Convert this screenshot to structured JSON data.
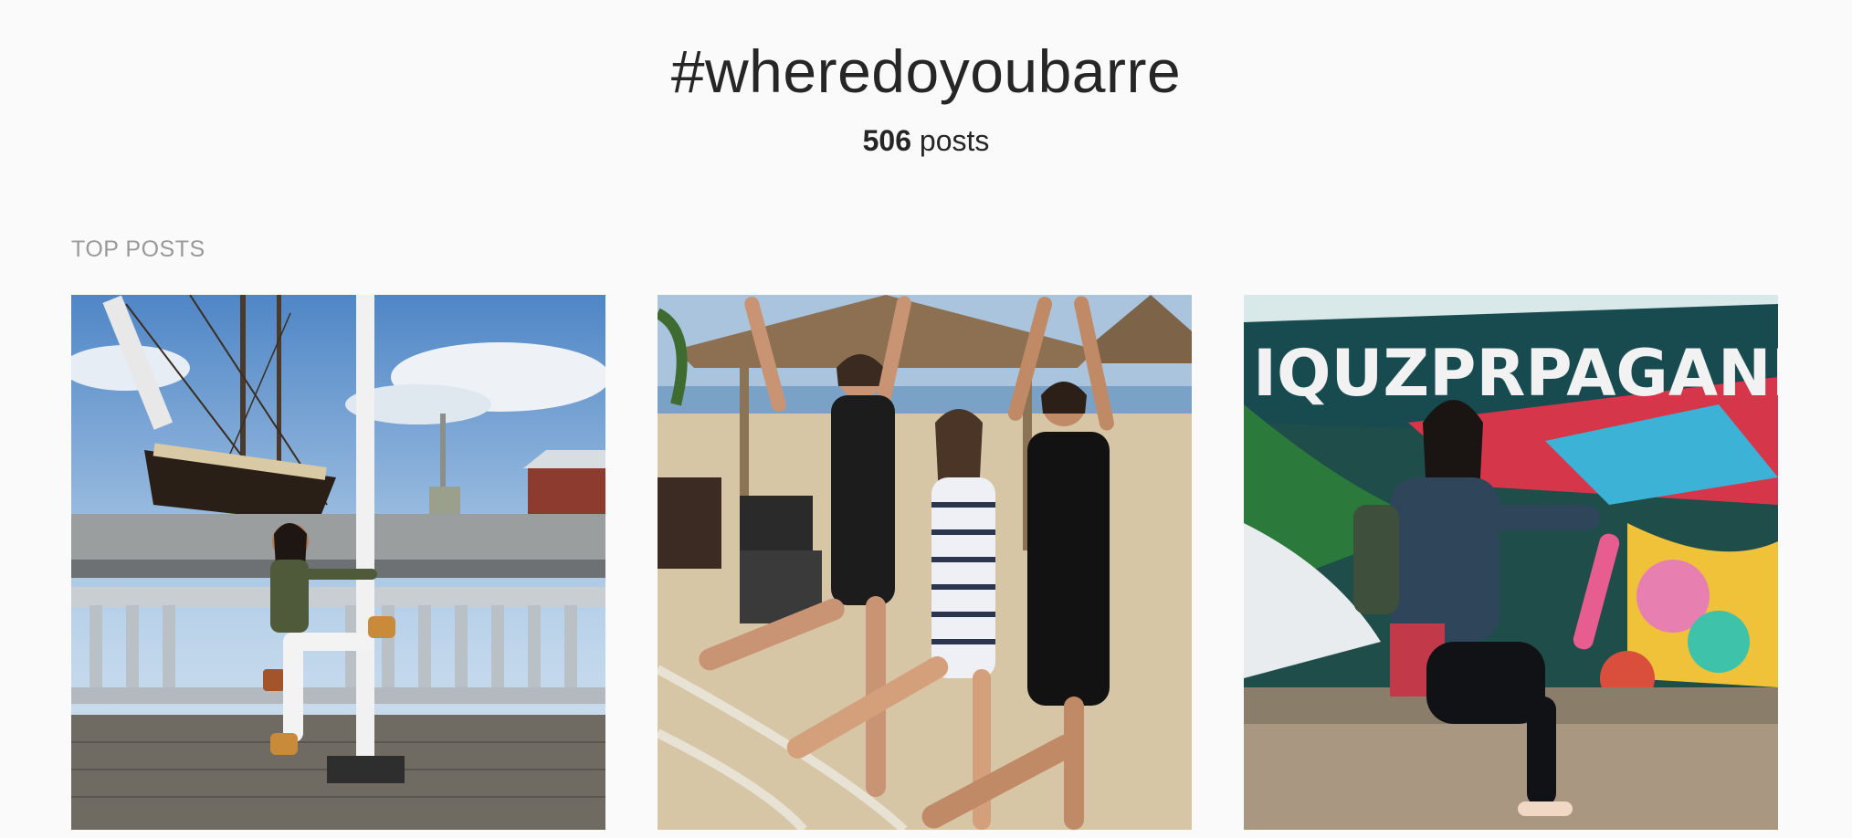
{
  "hashtag": {
    "title": "#wheredoyoubarre",
    "post_count": "506",
    "post_count_label": "posts"
  },
  "top_posts": {
    "heading": "TOP POSTS",
    "items": [
      {
        "id": "post-1",
        "alt": "Woman balancing by a pole at a dock with a tall ship"
      },
      {
        "id": "post-2",
        "alt": "Three women kicking a leg on a beach under thatched umbrellas"
      },
      {
        "id": "post-3",
        "alt": "Woman posing in front of a graffiti wall reading PROPAGANDA"
      }
    ],
    "graffiti_text": "IQUZPRPAGANDA"
  },
  "colors": {
    "background": "#fafafa",
    "text": "#262626",
    "muted": "#999999"
  }
}
